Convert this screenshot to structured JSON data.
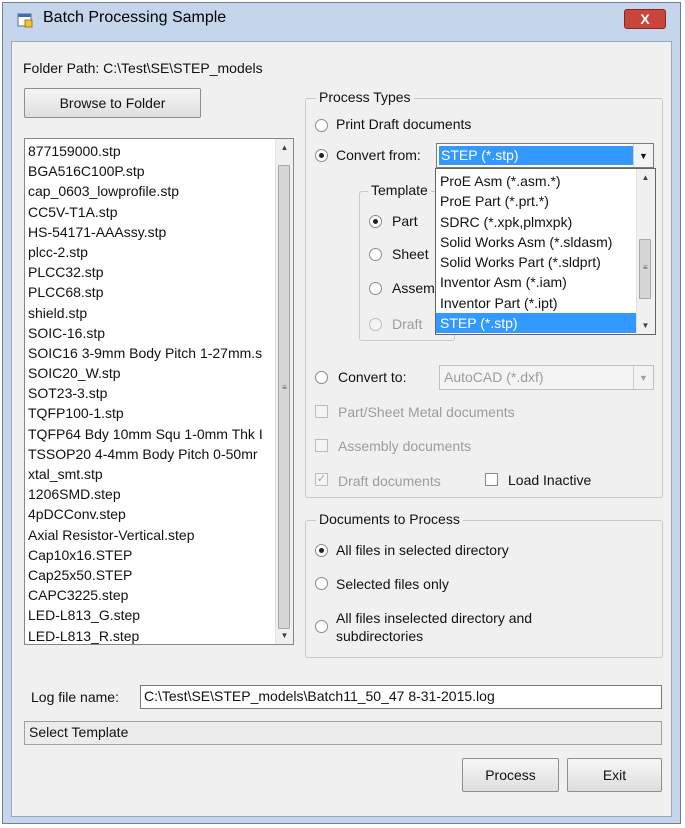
{
  "window": {
    "title": "Batch Processing Sample",
    "close_glyph": "X"
  },
  "folder": {
    "path_label": "Folder Path: C:\\Test\\SE\\STEP_models",
    "browse_label": "Browse to Folder"
  },
  "file_list": [
    "877159000.stp",
    "BGA516C100P.stp",
    "cap_0603_lowprofile.stp",
    "CC5V-T1A.stp",
    "HS-54171-AAAssy.stp",
    "plcc-2.stp",
    "PLCC32.stp",
    "PLCC68.stp",
    "shield.stp",
    "SOIC-16.stp",
    "SOIC16 3-9mm Body Pitch 1-27mm.s",
    "SOIC20_W.stp",
    "SOT23-3.stp",
    "TQFP100-1.stp",
    "TQFP64 Bdy 10mm Squ 1-0mm Thk I",
    "TSSOP20 4-4mm Body Pitch 0-50mr",
    "xtal_smt.stp",
    "1206SMD.step",
    "4pDCConv.step",
    "Axial Resistor-Vertical.step",
    "Cap10x16.STEP",
    "Cap25x50.STEP",
    "CAPC3225.step",
    "LED-L813_G.step",
    "LED-L813_R.step"
  ],
  "process_types": {
    "legend": "Process Types",
    "print_draft": "Print Draft documents",
    "convert_from": "Convert from:",
    "convert_from_value": "STEP (*.stp)",
    "dropdown_options": [
      "ProE Asm (*.asm.*)",
      "ProE Part (*.prt.*)",
      "SDRC (*.xpk,plmxpk)",
      "Solid Works Asm (*.sldasm)",
      "Solid Works Part (*.sldprt)",
      "Inventor Asm (*.iam)",
      "Inventor Part (*.ipt)",
      "STEP (*.stp)"
    ],
    "template_legend": "Template",
    "template_options": [
      "Part",
      "Sheet",
      "Assem",
      "Draft"
    ],
    "convert_to": "Convert to:",
    "convert_to_value": "AutoCAD (*.dxf)",
    "part_sheet": "Part/Sheet Metal documents",
    "assembly_docs": "Assembly documents",
    "draft_docs": "Draft documents",
    "load_inactive": "Load Inactive"
  },
  "documents": {
    "legend": "Documents to Process",
    "all_files": "All files in selected directory",
    "selected_files": "Selected files only",
    "all_subdirs_line1": "All files inselected directory and",
    "all_subdirs_line2": "subdirectories"
  },
  "log": {
    "label": "Log file name:",
    "value": "C:\\Test\\SE\\STEP_models\\Batch11_50_47 8-31-2015.log"
  },
  "status_text": "Select Template",
  "buttons": {
    "process": "Process",
    "exit": "Exit"
  },
  "colors": {
    "selection": "#3399ff",
    "close": "#c9463d",
    "frame": "#c5d6ec"
  },
  "icons": {
    "app": "form-icon",
    "close": "close-icon",
    "combo": "chevron-down-icon"
  }
}
